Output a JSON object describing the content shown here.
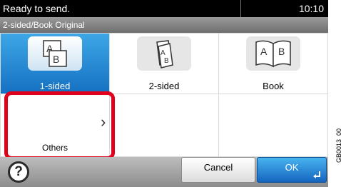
{
  "status": {
    "message": "Ready to send.",
    "time": "10:10"
  },
  "screen_title": "2-sided/Book Original",
  "options": [
    {
      "label": "1-sided",
      "icon": "one-sided-original-icon",
      "selected": true
    },
    {
      "label": "2-sided",
      "icon": "two-sided-original-icon",
      "selected": false
    },
    {
      "label": "Book",
      "icon": "book-original-icon",
      "selected": false
    },
    {
      "label": "Others",
      "icon": "chevron-right-icon",
      "selected": false
    }
  ],
  "footer": {
    "help_label": "?",
    "cancel_label": "Cancel",
    "ok_label": "OK"
  },
  "figure_code": "GB0013_00",
  "colors": {
    "accent_blue": "#1e88d8",
    "highlight_red": "#e0001b",
    "status_bar": "#000000"
  }
}
